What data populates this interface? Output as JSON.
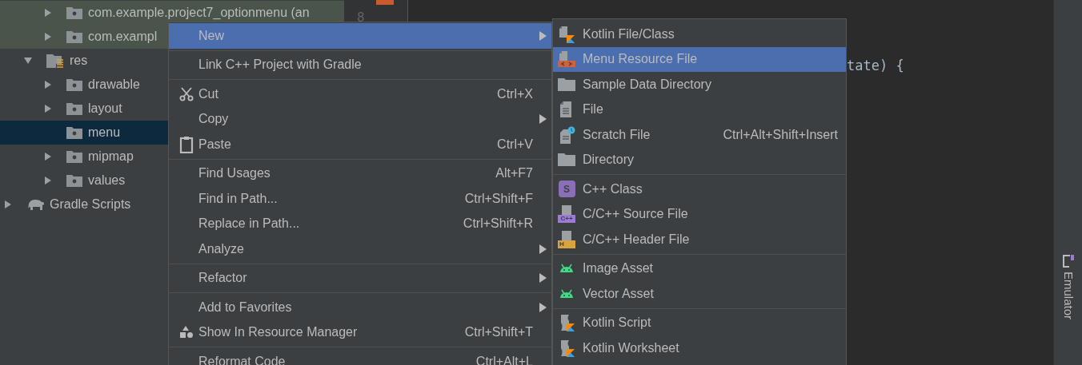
{
  "project_tree": {
    "items": [
      {
        "kind": "package",
        "label": "com.example.project7_optionmenu (an",
        "expanded": false,
        "highlighted": true,
        "selected": false
      },
      {
        "kind": "package",
        "label": "com.exampl",
        "expanded": false,
        "highlighted": true,
        "selected": false
      },
      {
        "kind": "resources",
        "label": "res",
        "expanded": true,
        "selected": false,
        "children": [
          {
            "kind": "folder",
            "label": "drawable",
            "expanded": false,
            "selected": false
          },
          {
            "kind": "folder",
            "label": "layout",
            "expanded": false,
            "selected": false
          },
          {
            "kind": "leaf",
            "label": "menu",
            "selected": true
          },
          {
            "kind": "folder",
            "label": "mipmap",
            "expanded": false,
            "selected": false
          },
          {
            "kind": "folder",
            "label": "values",
            "expanded": false,
            "selected": false
          }
        ]
      },
      {
        "kind": "gradle",
        "label": "Gradle Scripts",
        "expanded": false,
        "selected": false
      }
    ]
  },
  "editor": {
    "line_number": "8",
    "code_fragment": "tate) {"
  },
  "context_menu": {
    "groups": [
      [
        {
          "label": "New",
          "selected": true,
          "submenu": true
        }
      ],
      [
        {
          "label": "Link C++ Project with Gradle",
          "selected": false,
          "submenu": false
        }
      ],
      [
        {
          "kind": "scissors",
          "label": "Cut",
          "shortcut": "Ctrl+X",
          "selected": false,
          "submenu": false
        },
        {
          "label": "Copy",
          "selected": false,
          "submenu": true
        },
        {
          "kind": "clipboard",
          "label": "Paste",
          "shortcut": "Ctrl+V",
          "selected": false,
          "submenu": false
        }
      ],
      [
        {
          "label": "Find Usages",
          "shortcut": "Alt+F7",
          "selected": false,
          "submenu": false
        },
        {
          "label": "Find in Path...",
          "shortcut": "Ctrl+Shift+F",
          "selected": false,
          "submenu": false
        },
        {
          "label": "Replace in Path...",
          "shortcut": "Ctrl+Shift+R",
          "selected": false,
          "submenu": false
        },
        {
          "label": "Analyze",
          "selected": false,
          "submenu": true
        }
      ],
      [
        {
          "label": "Refactor",
          "selected": false,
          "submenu": true
        }
      ],
      [
        {
          "label": "Add to Favorites",
          "selected": false,
          "submenu": true
        },
        {
          "kind": "shapes",
          "label": "Show In Resource Manager",
          "shortcut": "Ctrl+Shift+T",
          "selected": false,
          "submenu": false
        }
      ],
      [
        {
          "label": "Reformat Code",
          "shortcut": "Ctrl+Alt+L",
          "selected": false,
          "submenu": false
        }
      ]
    ]
  },
  "new_submenu": {
    "groups": [
      [
        {
          "kind": "kotlin-file",
          "label": "Kotlin File/Class",
          "selected": false
        },
        {
          "kind": "resource-file",
          "label": "Menu Resource File",
          "selected": true
        },
        {
          "kind": "folder",
          "label": "Sample Data Directory",
          "selected": false
        },
        {
          "kind": "file",
          "label": "File",
          "selected": false
        },
        {
          "kind": "scratch",
          "label": "Scratch File",
          "shortcut": "Ctrl+Alt+Shift+Insert",
          "selected": false
        },
        {
          "kind": "folder",
          "label": "Directory",
          "selected": false
        }
      ],
      [
        {
          "kind": "class",
          "label": "C++ Class",
          "icon_text": "S",
          "selected": false
        },
        {
          "kind": "source",
          "label": "C/C++ Source File",
          "icon_text": "C++",
          "selected": false
        },
        {
          "kind": "header",
          "label": "C/C++ Header File",
          "icon_text": "H",
          "selected": false
        }
      ],
      [
        {
          "kind": "android",
          "label": "Image Asset",
          "selected": false
        },
        {
          "kind": "android",
          "label": "Vector Asset",
          "selected": false
        }
      ],
      [
        {
          "kind": "kotlin-script",
          "label": "Kotlin Script",
          "selected": false
        },
        {
          "kind": "kotlin-script",
          "label": "Kotlin Worksheet",
          "selected": false
        }
      ]
    ]
  },
  "tool_strip": {
    "label": "Emulator"
  }
}
